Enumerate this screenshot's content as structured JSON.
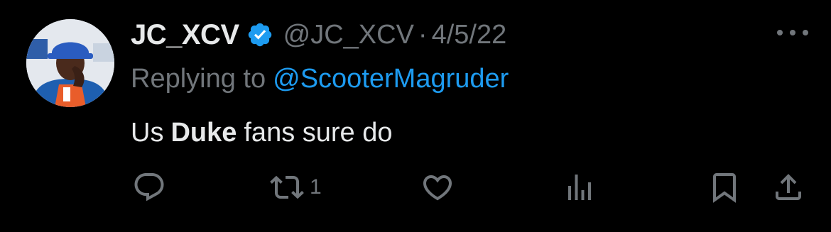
{
  "tweet": {
    "display_name": "JC_XCV",
    "handle": "@JC_XCV",
    "separator": "·",
    "date": "4/5/22",
    "replying_prefix": "Replying to",
    "replying_to": "@ScooterMagruder",
    "text_before": "Us",
    "text_bold": "Duke",
    "text_after": "fans sure do"
  },
  "actions": {
    "reply_icon": "reply-icon",
    "retweet_icon": "retweet-icon",
    "retweet_count": "1",
    "like_icon": "heart-icon",
    "views_icon": "views-icon",
    "bookmark_icon": "bookmark-icon",
    "share_icon": "share-icon"
  },
  "colors": {
    "background": "#000000",
    "text_primary": "#e7e9ea",
    "text_secondary": "#71767b",
    "accent": "#1d9bf0"
  }
}
